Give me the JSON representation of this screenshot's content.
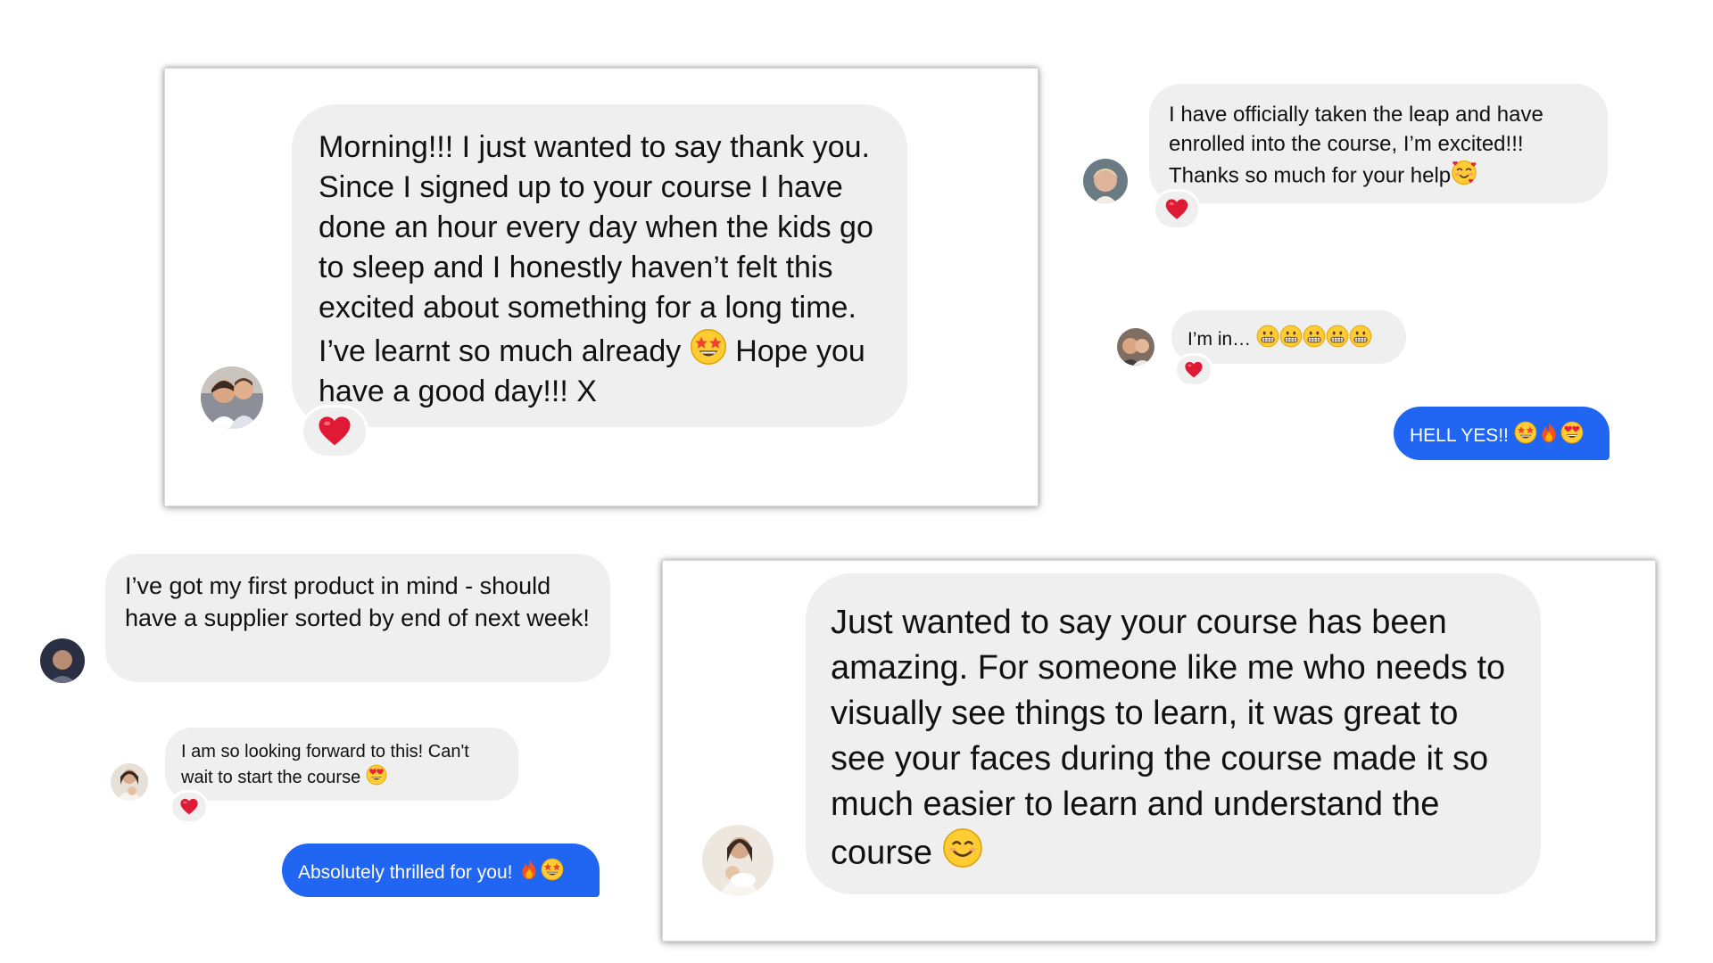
{
  "colors": {
    "bubble_gray": "#efefef",
    "bubble_blue": "#2166f3",
    "heart_red": "#e01935"
  },
  "messages": {
    "morning": {
      "text": "Morning!!! I just wanted to say thank you. Since I signed up to your course I have done an hour every day when the kids go to sleep and I honestly haven’t felt this excited about something for a long time. I’ve learnt so much already",
      "text_end": "Hope you have a good day!!! X",
      "emoji": "star-struck",
      "reaction": "red-heart"
    },
    "enrolled": {
      "text": "I have officially taken the leap and have enrolled into the course, I’m excited!!! Thanks so much for your help",
      "emoji": "smiling-face-with-hearts",
      "reaction": "red-heart"
    },
    "im_in": {
      "text": "I’m in…",
      "emojis": [
        "grimacing",
        "grimacing",
        "grimacing",
        "grimacing",
        "grimacing"
      ],
      "reaction": "red-heart"
    },
    "hell_yes": {
      "text": "HELL YES!!",
      "emojis": [
        "star-struck",
        "fire",
        "heart-eyes"
      ]
    },
    "first_product": {
      "text": "I’ve got my first product in mind - should have a supplier sorted by end of next week!"
    },
    "looking_forward": {
      "text": "I am so looking forward to this! Can't wait to start the course",
      "emoji": "heart-eyes",
      "reaction": "red-heart"
    },
    "thrilled": {
      "text": "Absolutely thrilled for you!",
      "emojis": [
        "fire",
        "star-struck"
      ]
    },
    "visual": {
      "text": "Just wanted to say your course has been amazing. For someone like me who needs to visually see things to learn, it was great to see your faces during the course made it so much easier to learn and understand the course",
      "emoji": "smiling-face"
    }
  }
}
